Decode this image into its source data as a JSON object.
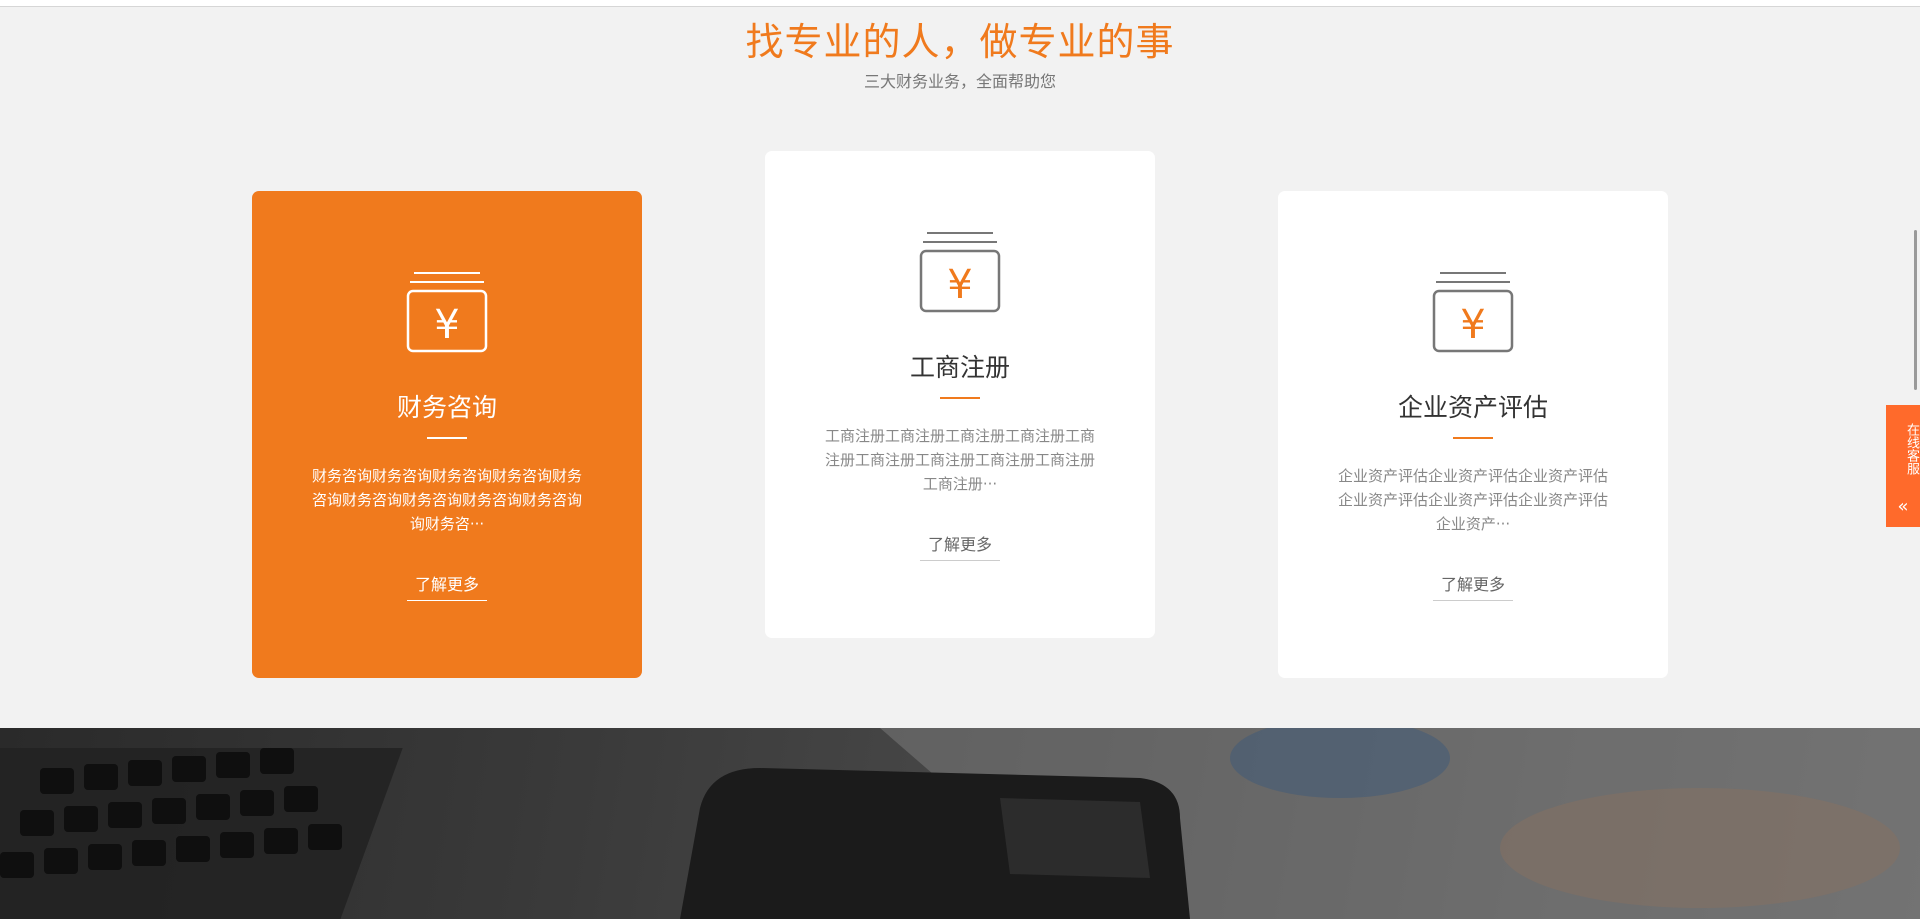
{
  "colors": {
    "accent": "#f07a1d",
    "service_tab": "#ff6a2b",
    "background": "#f2f2f2"
  },
  "section": {
    "title": "找专业的人，做专业的事",
    "subtitle": "三大财务业务，全面帮助您"
  },
  "cards": [
    {
      "icon": "yen-money-icon",
      "title": "财务咨询",
      "description": "财务咨询财务咨询财务咨询财务咨询财务咨询财务咨询财务咨询财务咨询财务咨询询财务咨···",
      "link": "了解更多",
      "active": true
    },
    {
      "icon": "yen-money-icon",
      "title": "工商注册",
      "description": "工商注册工商注册工商注册工商注册工商注册工商注册工商注册工商注册工商注册工商注册···",
      "link": "了解更多",
      "active": false
    },
    {
      "icon": "yen-money-icon",
      "title": "企业资产评估",
      "description": "企业资产评估企业资产评估企业资产评估企业资产评估企业资产评估企业资产评估企业资产···",
      "link": "了解更多",
      "active": false
    }
  ],
  "service_tab": {
    "label": "在线客服",
    "chevron": "«"
  }
}
